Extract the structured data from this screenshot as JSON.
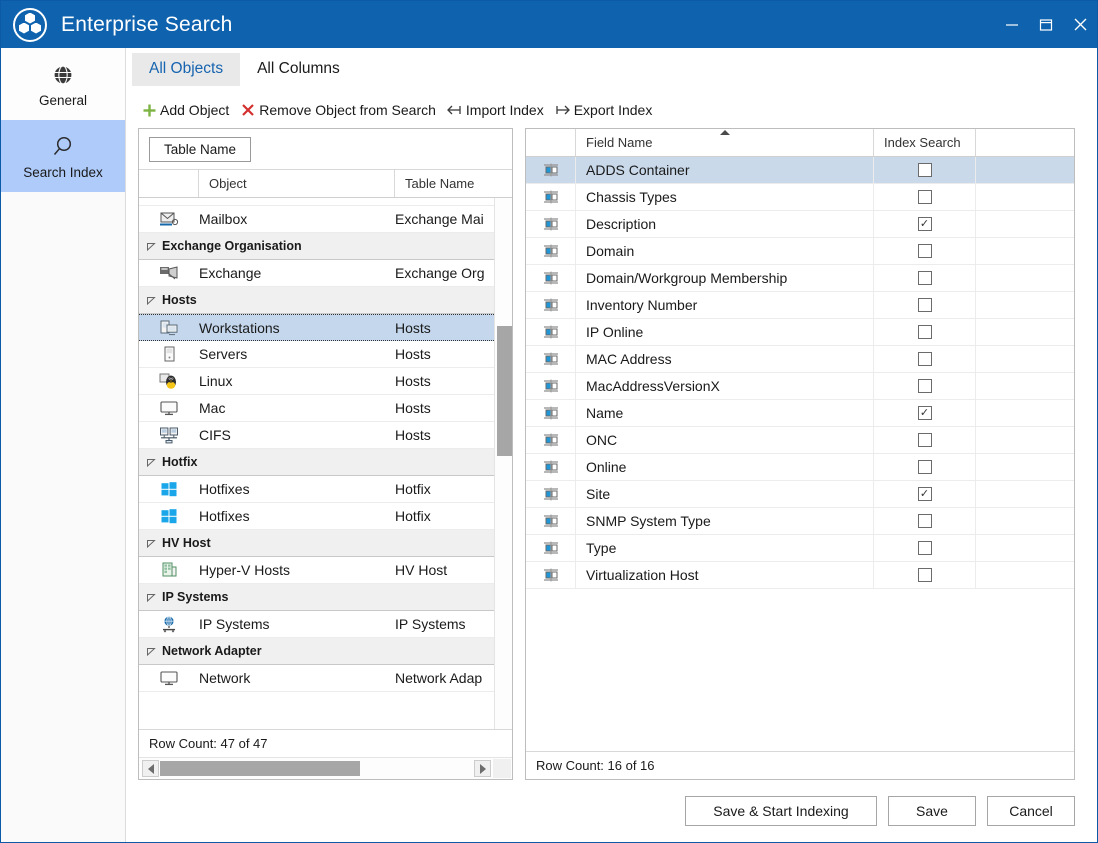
{
  "window": {
    "title": "Enterprise Search",
    "logo_icon": "app-logo-icon",
    "minimize_icon": "minimize-icon",
    "maximize_icon": "maximize-icon",
    "close_icon": "close-icon"
  },
  "sidebar": {
    "items": [
      {
        "label": "General",
        "icon": "globe-icon",
        "active": false
      },
      {
        "label": "Search Index",
        "icon": "magnifier-icon",
        "active": true
      }
    ]
  },
  "tabs": [
    {
      "label": "All Objects",
      "active": true
    },
    {
      "label": "All Columns",
      "active": false
    }
  ],
  "toolbar": {
    "buttons": [
      {
        "label": "Add Object",
        "icon": "plus-icon",
        "color": "#7cb342"
      },
      {
        "label": "Remove Object from Search",
        "icon": "cross-icon",
        "color": "#d32f2f"
      },
      {
        "label": "Import Index",
        "icon": "arrow-left-bar-icon",
        "color": "#3a3a3a"
      },
      {
        "label": "Export Index",
        "icon": "arrow-right-bar-icon",
        "color": "#3a3a3a"
      }
    ]
  },
  "left_panel": {
    "group_chip": "Table Name",
    "headers": [
      "",
      "Object",
      "Table Name"
    ],
    "rows": [
      {
        "type": "item",
        "icon": "mailbox-icon",
        "object": "Mailbox",
        "table": "Exchange Mai"
      },
      {
        "type": "group",
        "label": "Exchange Organisation"
      },
      {
        "type": "item",
        "icon": "exchange-icon",
        "object": "Exchange",
        "table": "Exchange Org"
      },
      {
        "type": "group",
        "label": "Hosts"
      },
      {
        "type": "item",
        "icon": "workstation-icon",
        "object": "Workstations",
        "table": "Hosts",
        "selected": true
      },
      {
        "type": "item",
        "icon": "server-icon",
        "object": "Servers",
        "table": "Hosts"
      },
      {
        "type": "item",
        "icon": "linux-icon",
        "object": "Linux",
        "table": "Hosts"
      },
      {
        "type": "item",
        "icon": "monitor-icon",
        "object": "Mac",
        "table": "Hosts"
      },
      {
        "type": "item",
        "icon": "cifs-icon",
        "object": "CIFS",
        "table": "Hosts"
      },
      {
        "type": "group",
        "label": "Hotfix"
      },
      {
        "type": "item",
        "icon": "windows-icon",
        "object": "Hotfixes",
        "table": "Hotfix"
      },
      {
        "type": "item",
        "icon": "windows-icon",
        "object": "Hotfixes",
        "table": "Hotfix"
      },
      {
        "type": "group",
        "label": "HV Host"
      },
      {
        "type": "item",
        "icon": "hyperv-icon",
        "object": "Hyper-V Hosts",
        "table": "HV Host"
      },
      {
        "type": "group",
        "label": "IP Systems"
      },
      {
        "type": "item",
        "icon": "ip-systems-icon",
        "object": "IP Systems",
        "table": "IP Systems"
      },
      {
        "type": "group",
        "label": "Network Adapter"
      },
      {
        "type": "item",
        "icon": "monitor-icon",
        "object": "Network",
        "table": "Network Adap"
      }
    ],
    "status": "Row Count: 47 of 47"
  },
  "right_panel": {
    "headers": [
      "",
      "Field Name",
      "Index Search",
      ""
    ],
    "sort_column": "Field Name",
    "sort_direction": "ascending",
    "rows": [
      {
        "icon": "field-icon",
        "name": "ADDS Container",
        "checked": false,
        "selected": true
      },
      {
        "icon": "field-icon",
        "name": "Chassis Types",
        "checked": false
      },
      {
        "icon": "field-icon",
        "name": "Description",
        "checked": true
      },
      {
        "icon": "field-icon",
        "name": "Domain",
        "checked": false
      },
      {
        "icon": "field-icon",
        "name": "Domain/Workgroup Membership",
        "checked": false
      },
      {
        "icon": "field-icon",
        "name": "Inventory Number",
        "checked": false
      },
      {
        "icon": "field-icon",
        "name": "IP Online",
        "checked": false
      },
      {
        "icon": "field-icon",
        "name": "MAC Address",
        "checked": false
      },
      {
        "icon": "field-icon",
        "name": "MacAddressVersionX",
        "checked": false
      },
      {
        "icon": "field-icon",
        "name": "Name",
        "checked": true
      },
      {
        "icon": "field-icon",
        "name": "ONC",
        "checked": false
      },
      {
        "icon": "field-icon",
        "name": "Online",
        "checked": false
      },
      {
        "icon": "field-icon",
        "name": "Site",
        "checked": true
      },
      {
        "icon": "field-icon",
        "name": "SNMP System Type",
        "checked": false
      },
      {
        "icon": "field-icon",
        "name": "Type",
        "checked": false
      },
      {
        "icon": "field-icon",
        "name": "Virtualization Host",
        "checked": false
      }
    ],
    "status": "Row Count: 16 of 16"
  },
  "footer": {
    "save_start_indexing_label": "Save & Start Indexing",
    "save_label": "Save",
    "cancel_label": "Cancel"
  },
  "colors": {
    "titlebar": "#0f62ad",
    "sidebar_active": "#aecbfa",
    "tab_active_bg": "#e9e9e9",
    "tab_active_text": "#1764b0",
    "row_selected": "#c9d9ea",
    "add_icon": "#7cb342",
    "remove_icon": "#d32f2f"
  },
  "checkmark_glyph": "✓"
}
